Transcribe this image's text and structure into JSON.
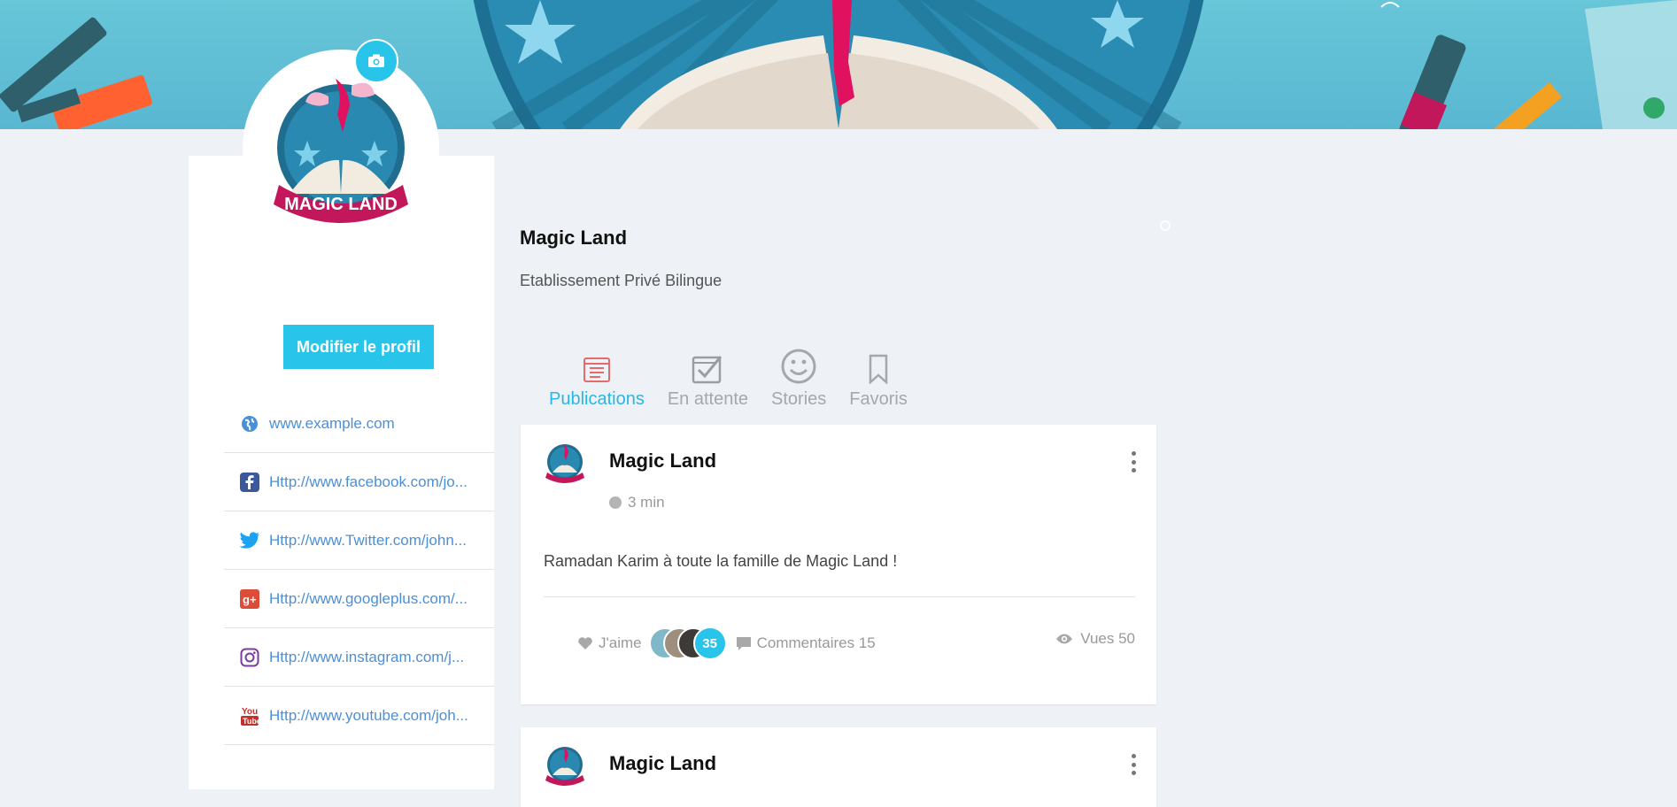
{
  "profile": {
    "name": "Magic Land",
    "subtitle": "Etablissement Privé Bilingue",
    "logo_text": "MAGIC LAND",
    "edit_button": "Modifier le profil"
  },
  "links": [
    {
      "icon": "globe-icon",
      "text": "www.example.com"
    },
    {
      "icon": "facebook-icon",
      "text": "Http://www.facebook.com/jo..."
    },
    {
      "icon": "twitter-icon",
      "text": "Http://www.Twitter.com/john..."
    },
    {
      "icon": "googleplus-icon",
      "text": "Http://www.googleplus.com/..."
    },
    {
      "icon": "instagram-icon",
      "text": "Http://www.instagram.com/j..."
    },
    {
      "icon": "youtube-icon",
      "text": "Http://www.youtube.com/joh..."
    }
  ],
  "tabs": [
    {
      "icon": "publications-icon",
      "label": "Publications",
      "active": true
    },
    {
      "icon": "pending-icon",
      "label": "En attente",
      "active": false
    },
    {
      "icon": "smiley-icon",
      "label": "Stories",
      "active": false
    },
    {
      "icon": "bookmark-icon",
      "label": "Favoris",
      "active": false
    }
  ],
  "posts": [
    {
      "author": "Magic Land",
      "time": "3 min",
      "text": "Ramadan Karim à toute la famille de Magic Land !",
      "like_label": "J'aime",
      "reactions_count": "35",
      "comments_label": "Commentaires 15",
      "views_label": "Vues 50"
    },
    {
      "author": "Magic Land"
    }
  ],
  "colors": {
    "accent": "#29c4ea",
    "link": "#4a90d9",
    "active_tab": "#29b6e2",
    "tab_icon_active": "#e36b6b",
    "background": "#eef1f5"
  }
}
